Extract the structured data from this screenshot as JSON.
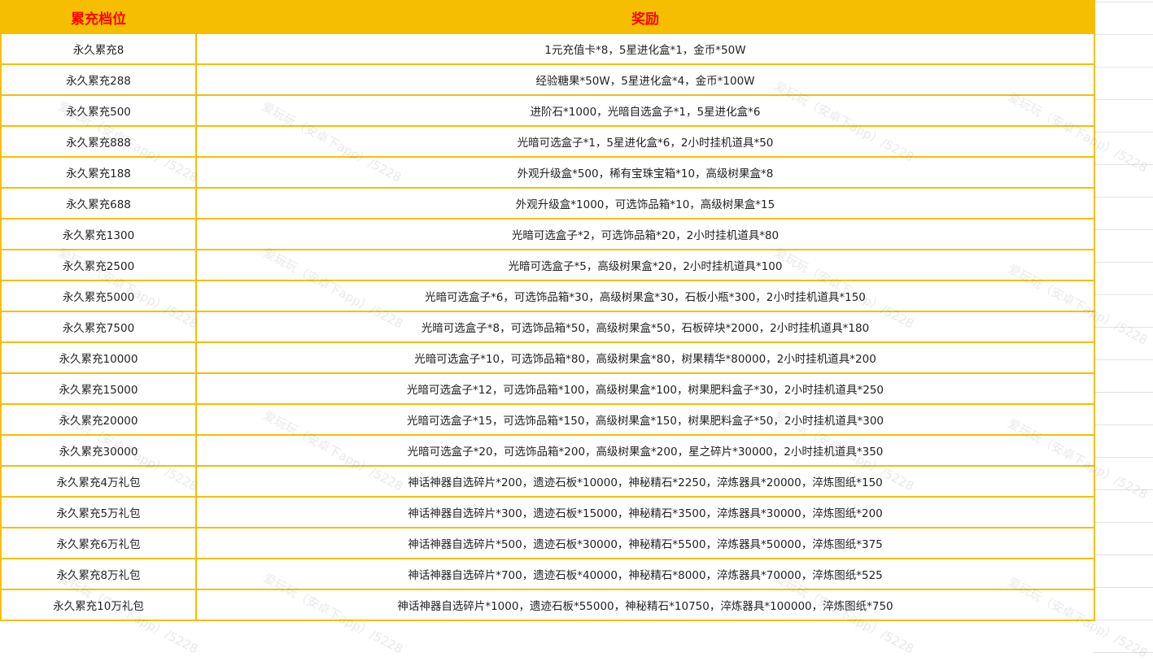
{
  "header": {
    "tier_label": "累充档位",
    "reward_label": "奖励"
  },
  "rows": [
    {
      "tier": "永久累充8",
      "reward": "1元充值卡*8，5星进化盒*1，金币*50W"
    },
    {
      "tier": "永久累充288",
      "reward": "经验糖果*50W，5星进化盒*4，金币*100W"
    },
    {
      "tier": "永久累充500",
      "reward": "进阶石*1000，光暗自选盒子*1，5星进化盒*6"
    },
    {
      "tier": "永久累充888",
      "reward": "光暗可选盒子*1，5星进化盒*6，2小时挂机道具*50"
    },
    {
      "tier": "永久累充188",
      "reward": "外观升级盒*500，稀有宝珠宝箱*10，高级树果盒*8"
    },
    {
      "tier": "永久累充688",
      "reward": "外观升级盒*1000，可选饰品箱*10，高级树果盒*15"
    },
    {
      "tier": "永久累充1300",
      "reward": "光暗可选盒子*2，可选饰品箱*20，2小时挂机道具*80"
    },
    {
      "tier": "永久累充2500",
      "reward": "光暗可选盒子*5，高级树果盒*20，2小时挂机道具*100"
    },
    {
      "tier": "永久累充5000",
      "reward": "光暗可选盒子*6，可选饰品箱*30，高级树果盒*30，石板小瓶*300，2小时挂机道具*150"
    },
    {
      "tier": "永久累充7500",
      "reward": "光暗可选盒子*8，可选饰品箱*50，高级树果盒*50，石板碎块*2000，2小时挂机道具*180"
    },
    {
      "tier": "永久累充10000",
      "reward": "光暗可选盒子*10，可选饰品箱*80，高级树果盒*80，树果精华*80000，2小时挂机道具*200"
    },
    {
      "tier": "永久累充15000",
      "reward": "光暗可选盒子*12，可选饰品箱*100，高级树果盒*100，树果肥料盒子*30，2小时挂机道具*250"
    },
    {
      "tier": "永久累充20000",
      "reward": "光暗可选盒子*15，可选饰品箱*150，高级树果盒*150，树果肥料盒子*50，2小时挂机道具*300"
    },
    {
      "tier": "永久累充30000",
      "reward": "光暗可选盒子*20，可选饰品箱*200，高级树果盒*200，星之碎片*30000，2小时挂机道具*350"
    },
    {
      "tier": "永久累充4万礼包",
      "reward": "神话神器自选碎片*200，遗迹石板*10000，神秘精石*2250，淬炼器具*20000，淬炼图纸*150"
    },
    {
      "tier": "永久累充5万礼包",
      "reward": "神话神器自选碎片*300，遗迹石板*15000，神秘精石*3500，淬炼器具*30000，淬炼图纸*200"
    },
    {
      "tier": "永久累充6万礼包",
      "reward": "神话神器自选碎片*500，遗迹石板*30000，神秘精石*5500，淬炼器具*50000，淬炼图纸*375"
    },
    {
      "tier": "永久累充8万礼包",
      "reward": "神话神器自选碎片*700，遗迹石板*40000，神秘精石*8000，淬炼器具*70000，淬炼图纸*525"
    },
    {
      "tier": "永久累充10万礼包",
      "reward": "神话神器自选碎片*1000，遗迹石板*55000，神秘精石*10750，淬炼器具*100000，淬炼图纸*750"
    }
  ],
  "watermark": "爱玩玩（安卓下app）/5228",
  "colors": {
    "header_bg": "#f5bf00",
    "header_text": "#ff0000",
    "border": "#f5bf00"
  }
}
